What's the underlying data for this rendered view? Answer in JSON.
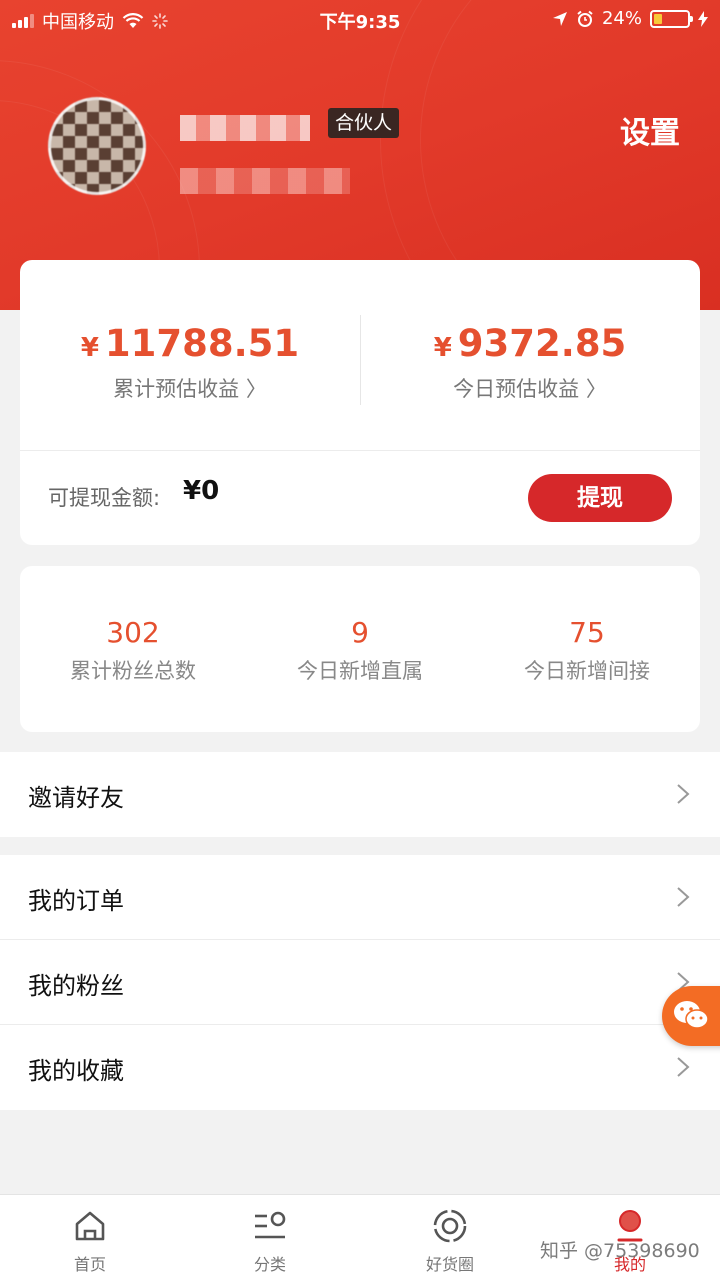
{
  "status_bar": {
    "carrier": "中国移动",
    "time": "下午9:35",
    "battery_pct": "24%",
    "battery_level": 0.24
  },
  "profile": {
    "badge": "合伙人",
    "settings_label": "设置"
  },
  "earnings": {
    "currency_symbol": "¥",
    "total_amount": "11788.51",
    "total_label": "累计预估收益 〉",
    "today_amount": "9372.85",
    "today_label": "今日预估收益 〉",
    "withdrawable_label": "可提现金额:",
    "withdrawable_value": "¥0",
    "withdraw_button": "提现"
  },
  "fans": {
    "items": [
      {
        "value": "302",
        "label": "累计粉丝总数"
      },
      {
        "value": "9",
        "label": "今日新增直属"
      },
      {
        "value": "75",
        "label": "今日新增间接"
      }
    ]
  },
  "menu": {
    "invite": "邀请好友",
    "orders": "我的订单",
    "fans": "我的粉丝",
    "favorites": "我的收藏"
  },
  "tabbar": {
    "items": [
      {
        "label": "首页",
        "icon": "home-icon"
      },
      {
        "label": "分类",
        "icon": "category-icon"
      },
      {
        "label": "好货圈",
        "icon": "goods-circle-icon"
      },
      {
        "label": "我的",
        "icon": "profile-icon"
      }
    ],
    "active_index": 3
  },
  "watermark": "知乎 @75398690",
  "colors": {
    "brand_red": "#e23a2a",
    "amount_orange": "#e5502f",
    "button_red": "#d6282a",
    "float_orange": "#f36c24"
  }
}
